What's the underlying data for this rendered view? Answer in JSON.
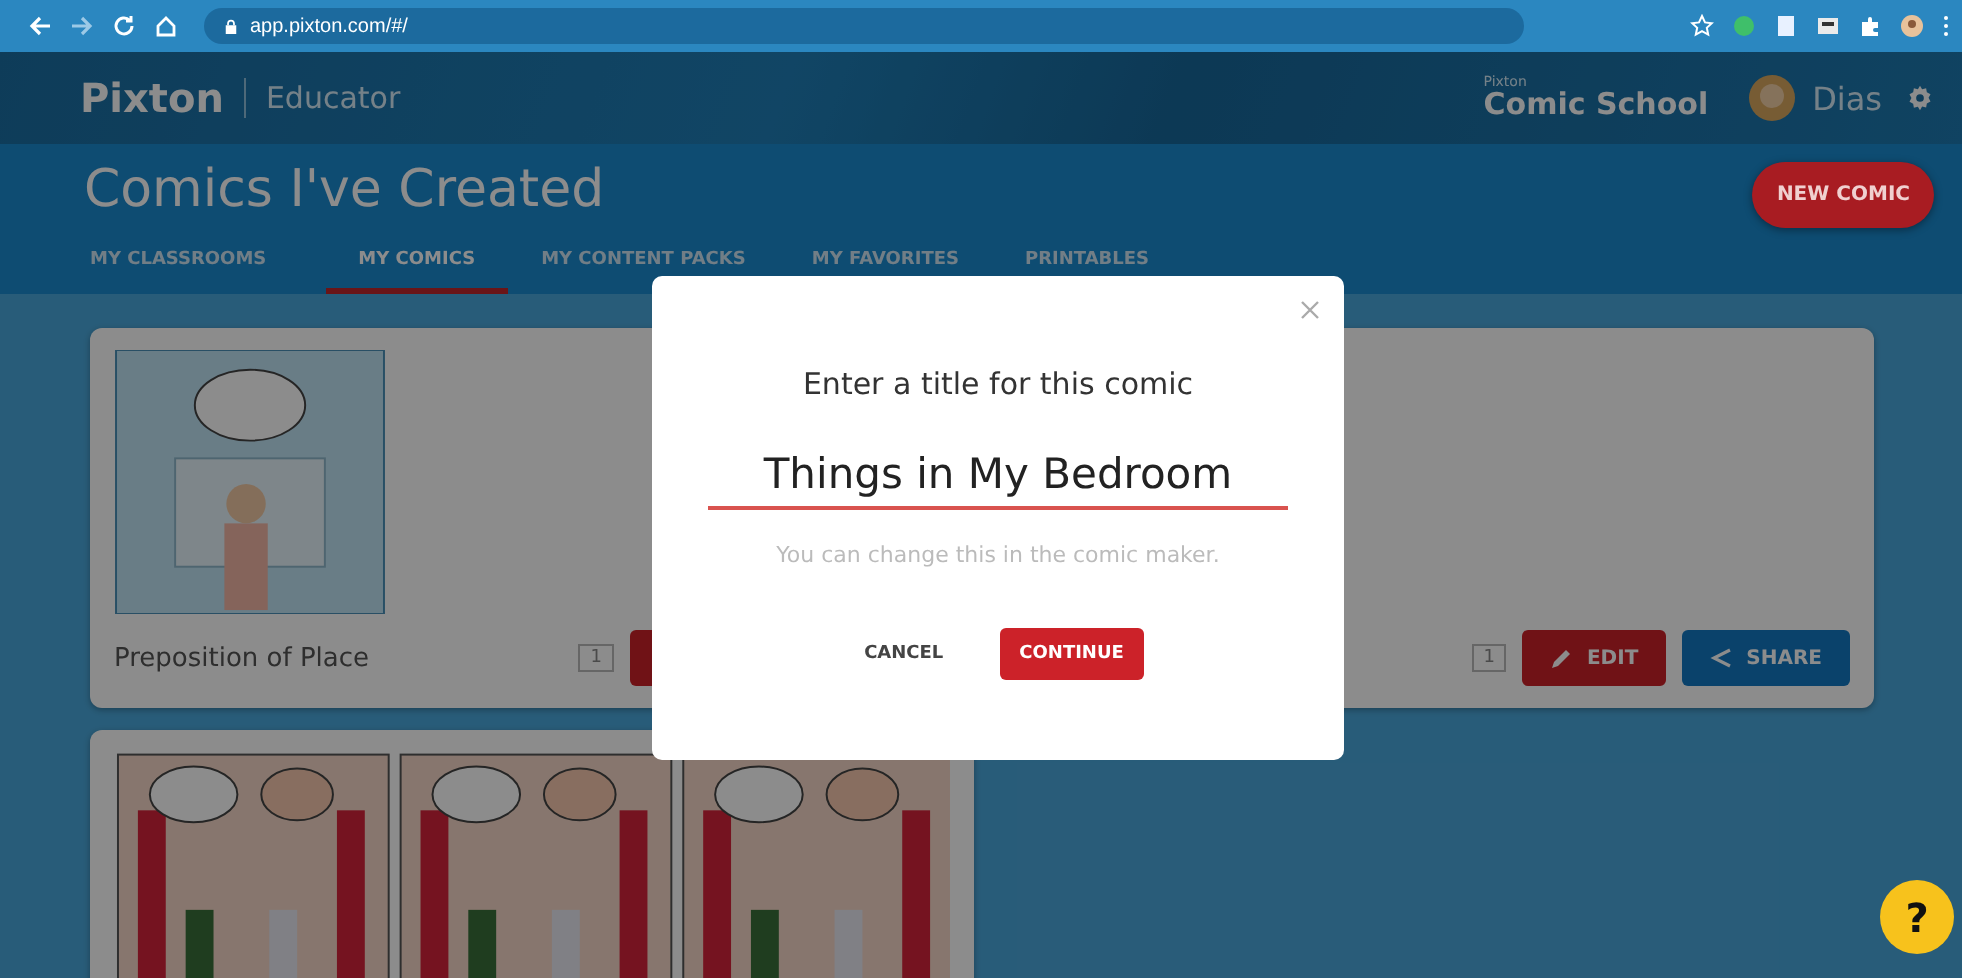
{
  "browser": {
    "url": "app.pixton.com/#/"
  },
  "header": {
    "logo": "Pixton",
    "section": "Educator",
    "school_caption": "Pixton",
    "school": "Comic School",
    "user": "Dias"
  },
  "page": {
    "title": "Comics I've Created"
  },
  "tabs": [
    {
      "label": "MY CLASSROOMS",
      "selected": false
    },
    {
      "label": "MY COMICS",
      "selected": true
    },
    {
      "label": "MY CONTENT PACKS",
      "selected": false
    },
    {
      "label": "MY FAVORITES",
      "selected": false
    },
    {
      "label": "PRINTABLES",
      "selected": false
    }
  ],
  "new_comic_button": "NEW COMIC",
  "comics": [
    {
      "kind": "single",
      "title": "Preposition of Place",
      "pages": "1"
    },
    {
      "kind": "single",
      "pages": "1",
      "edit": "EDIT",
      "share": "SHARE"
    },
    {
      "kind": "strip"
    }
  ],
  "modal": {
    "title": "Enter a title for this comic",
    "value": "Things in My Bedroom",
    "hint": "You can change this in the comic maker.",
    "buttons": [
      {
        "kind": "text",
        "label": "CANCEL"
      },
      {
        "kind": "primary",
        "label": "CONTINUE"
      }
    ]
  },
  "help_button": "?"
}
